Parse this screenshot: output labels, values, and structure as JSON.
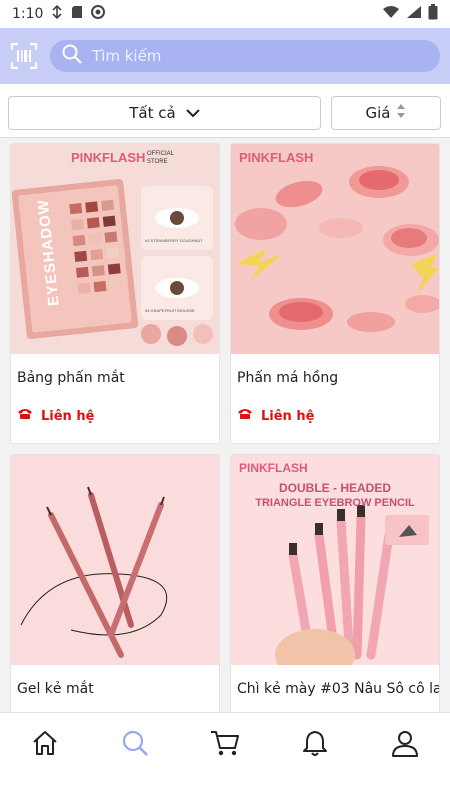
{
  "status": {
    "time": "1:10"
  },
  "search": {
    "placeholder": "Tìm kiếm"
  },
  "filters": {
    "category_label": "Tất cả",
    "price_label": "Giá"
  },
  "products": [
    {
      "name": "Bảng phấn mắt",
      "contact_label": "Liên hệ",
      "image_text": [
        "PINKFLASH",
        "OFFICIAL STORE",
        "EYESHADOW",
        "#3 STRAWBERRY DOUGHNUT",
        "#4 GRAPEFRUIT MOUSSE"
      ]
    },
    {
      "name": "Phấn má hồng",
      "contact_label": "Liên hệ",
      "image_text": [
        "PINKFLASH"
      ]
    },
    {
      "name": "Gel kẻ mắt",
      "contact_label": "",
      "image_text": []
    },
    {
      "name": "Chì kẻ mày #03 Nâu Sô cô la",
      "contact_label": "",
      "image_text": [
        "PINKFLASH",
        "DOUBLE - HEADED",
        "TRIANGLE EYEBROW PENCIL"
      ]
    }
  ],
  "nav": {
    "items": [
      "home-icon",
      "search-icon",
      "cart-icon",
      "bell-icon",
      "user-icon"
    ],
    "active": "search-icon"
  },
  "colors": {
    "accent": "#c7cdf7",
    "search_bg": "#a9b3f2",
    "contact_red": "#d11111",
    "nav_active": "#9aa6ee"
  }
}
